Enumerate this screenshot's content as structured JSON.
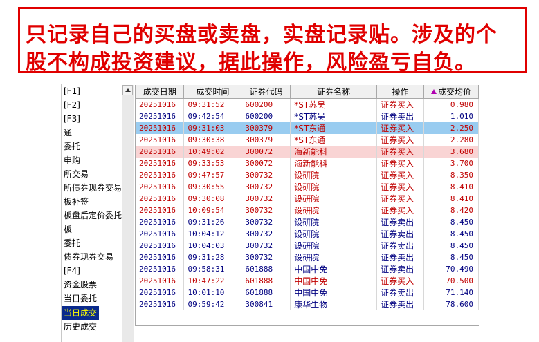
{
  "banner": {
    "line1": "只记录自己的买盘或卖盘，实盘记录贴。涉及的个",
    "line2": "股不构成投资建议，据此操作，风险盈亏自负。"
  },
  "nav": {
    "items": [
      "[F1]",
      "[F2]",
      "[F3]",
      "通",
      "委托",
      "申购",
      "所交易",
      "所债券现券交易",
      "板补签",
      "板盘后定价委托",
      "板",
      "委托",
      "债券现券交易",
      "[F4]",
      "资金股票",
      "当日委托",
      "当日成交",
      "历史成交"
    ],
    "active_index": 16
  },
  "table": {
    "headers": [
      "成交日期",
      "成交时间",
      "证券代码",
      "证券名称",
      "操作",
      "成交均价"
    ],
    "rows": [
      {
        "date": "20251016",
        "time": "09:31:52",
        "code": "600200",
        "name": "*ST苏吴",
        "op": "证券买入",
        "price": "0.980",
        "side": "buy",
        "state": ""
      },
      {
        "date": "20251016",
        "time": "09:42:54",
        "code": "600200",
        "name": "*ST苏吴",
        "op": "证券卖出",
        "price": "1.010",
        "side": "sell",
        "state": ""
      },
      {
        "date": "20251016",
        "time": "09:31:03",
        "code": "300379",
        "name": "*ST东通",
        "op": "证券买入",
        "price": "2.250",
        "side": "buy",
        "state": "selected"
      },
      {
        "date": "20251016",
        "time": "09:30:38",
        "code": "300379",
        "name": "*ST东通",
        "op": "证券买入",
        "price": "2.280",
        "side": "buy",
        "state": ""
      },
      {
        "date": "20251016",
        "time": "10:49:02",
        "code": "300072",
        "name": "海新能科",
        "op": "证券买入",
        "price": "3.680",
        "side": "buy",
        "state": "highlight"
      },
      {
        "date": "20251016",
        "time": "09:33:53",
        "code": "300072",
        "name": "海新能科",
        "op": "证券买入",
        "price": "3.700",
        "side": "buy",
        "state": ""
      },
      {
        "date": "20251016",
        "time": "09:47:57",
        "code": "300732",
        "name": "设研院",
        "op": "证券买入",
        "price": "8.350",
        "side": "buy",
        "state": ""
      },
      {
        "date": "20251016",
        "time": "09:30:55",
        "code": "300732",
        "name": "设研院",
        "op": "证券买入",
        "price": "8.410",
        "side": "buy",
        "state": ""
      },
      {
        "date": "20251016",
        "time": "09:30:08",
        "code": "300732",
        "name": "设研院",
        "op": "证券买入",
        "price": "8.410",
        "side": "buy",
        "state": ""
      },
      {
        "date": "20251016",
        "time": "10:09:54",
        "code": "300732",
        "name": "设研院",
        "op": "证券买入",
        "price": "8.420",
        "side": "buy",
        "state": ""
      },
      {
        "date": "20251016",
        "time": "09:31:26",
        "code": "300732",
        "name": "设研院",
        "op": "证券卖出",
        "price": "8.450",
        "side": "sell",
        "state": ""
      },
      {
        "date": "20251016",
        "time": "10:04:12",
        "code": "300732",
        "name": "设研院",
        "op": "证券卖出",
        "price": "8.450",
        "side": "sell",
        "state": ""
      },
      {
        "date": "20251016",
        "time": "10:04:03",
        "code": "300732",
        "name": "设研院",
        "op": "证券卖出",
        "price": "8.450",
        "side": "sell",
        "state": ""
      },
      {
        "date": "20251016",
        "time": "09:31:28",
        "code": "300732",
        "name": "设研院",
        "op": "证券卖出",
        "price": "8.450",
        "side": "sell",
        "state": ""
      },
      {
        "date": "20251016",
        "time": "09:58:31",
        "code": "601888",
        "name": "中国中免",
        "op": "证券卖出",
        "price": "70.490",
        "side": "sell",
        "state": ""
      },
      {
        "date": "20251016",
        "time": "10:47:22",
        "code": "601888",
        "name": "中国中免",
        "op": "证券买入",
        "price": "70.500",
        "side": "buy",
        "state": ""
      },
      {
        "date": "20251016",
        "time": "10:01:10",
        "code": "601888",
        "name": "中国中免",
        "op": "证券卖出",
        "price": "71.140",
        "side": "sell",
        "state": ""
      },
      {
        "date": "20251016",
        "time": "09:59:42",
        "code": "300841",
        "name": "康华生物",
        "op": "证券卖出",
        "price": "78.600",
        "side": "sell",
        "state": ""
      }
    ]
  },
  "colors": {
    "banner_red": "#e00000",
    "buy_text": "#c00000",
    "sell_text": "#000080",
    "selected_row": "#99ccf0",
    "highlight_row": "#f9d4d4",
    "nav_active_bg": "#0a2a8c",
    "nav_active_text": "#ffff00"
  },
  "icons": {
    "sort_indicator": "triangle-up-icon",
    "scroll_up": "scroll-up-arrow-icon"
  }
}
